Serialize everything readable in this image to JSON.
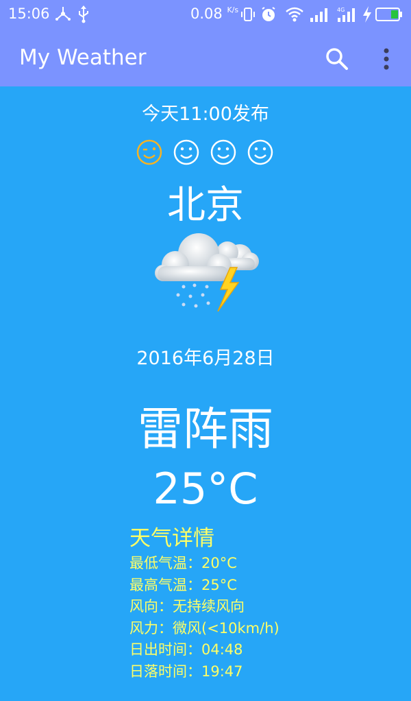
{
  "status_bar": {
    "time": "15:06",
    "net_speed": "0.08",
    "net_speed_unit": "K/s",
    "icons": [
      "usb-share-icon",
      "usb-icon",
      "vibrate-icon",
      "alarm-icon",
      "wifi-icon",
      "signal-icon",
      "signal-4g-icon",
      "charging-icon",
      "battery-icon"
    ]
  },
  "toolbar": {
    "title": "My Weather",
    "search_icon": "search-icon",
    "more_icon": "more-vert-icon"
  },
  "weather": {
    "publish_time": "今天11:00发布",
    "city": "北京",
    "icon": "thunderstorm-icon",
    "date": "2016年6月28日",
    "condition": "雷阵雨",
    "temperature": "25°C"
  },
  "faces": [
    {
      "name": "wink-face-icon",
      "color": "#f5b324"
    },
    {
      "name": "smile-face-icon",
      "color": "#ffffff"
    },
    {
      "name": "smile-face-icon",
      "color": "#ffffff"
    },
    {
      "name": "smile-face-icon",
      "color": "#ffffff"
    }
  ],
  "details": {
    "title": "天气详情",
    "lines": [
      "最低气温：20°C",
      "最高气温：25°C",
      "风向：无持续风向",
      "风力：微风(<10km/h)",
      "日出时间：04:48",
      "日落时间：19:47"
    ]
  },
  "colors": {
    "app_bar": "#7b93ff",
    "background": "#26a6f7",
    "detail_text": "#ffff66",
    "battery_fill": "#29c43d"
  }
}
